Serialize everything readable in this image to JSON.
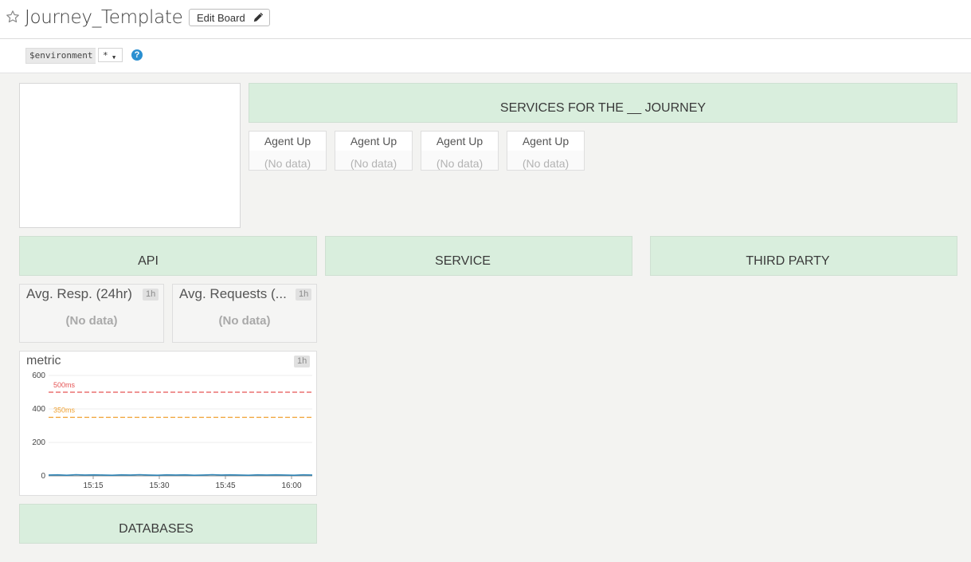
{
  "header": {
    "title": "Journey_Template",
    "edit_label": "Edit Board"
  },
  "template_vars": {
    "name": "$environment",
    "value": "*",
    "help": "?"
  },
  "widgets": {
    "services_heading": "SERVICES FOR THE __ JOURNEY",
    "agents": [
      {
        "title": "Agent Up",
        "value": "(No data)"
      },
      {
        "title": "Agent Up",
        "value": "(No data)"
      },
      {
        "title": "Agent Up",
        "value": "(No data)"
      },
      {
        "title": "Agent Up",
        "value": "(No data)"
      }
    ],
    "notes": {
      "api": "API",
      "service": "SERVICE",
      "third_party": "THIRD PARTY",
      "databases": "DATABASES"
    },
    "metrics": [
      {
        "title": "Avg. Resp. (24hr)",
        "badge": "1h",
        "value": "(No data)"
      },
      {
        "title": "Avg. Requests (...",
        "badge": "1h",
        "value": "(No data)"
      }
    ],
    "timeseries": {
      "title": "metric",
      "badge": "1h"
    }
  },
  "chart_data": {
    "type": "line",
    "x_ticks": [
      "15:15",
      "15:30",
      "15:45",
      "16:00"
    ],
    "ylim": [
      0,
      600
    ],
    "y_ticks": [
      0,
      200,
      400,
      600
    ],
    "series": [
      {
        "color": "#2c83b5",
        "values": [
          5,
          6,
          4,
          7,
          5,
          6,
          5,
          4,
          6,
          5,
          7,
          5,
          4,
          6,
          5,
          6,
          4,
          5,
          7,
          5,
          6,
          5,
          4,
          6,
          5,
          6,
          5,
          4,
          6,
          5
        ]
      }
    ],
    "markers": [
      {
        "label": "500ms",
        "value": 500,
        "color": "#e55353"
      },
      {
        "label": "350ms",
        "value": 350,
        "color": "#f0a030"
      }
    ],
    "grid": true
  }
}
